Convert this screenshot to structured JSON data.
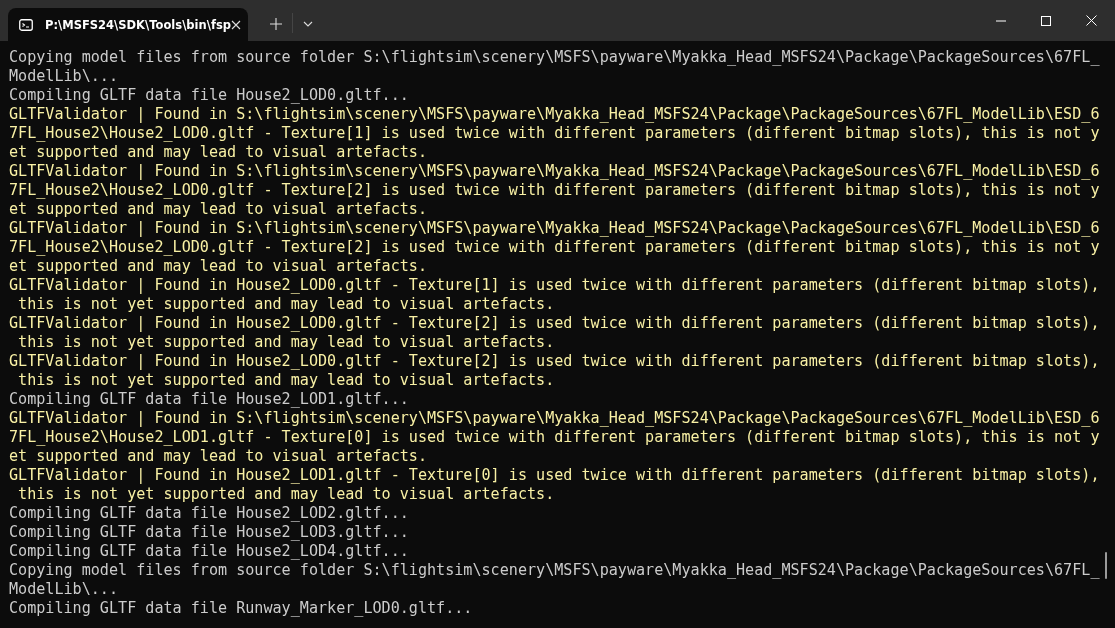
{
  "window": {
    "tab": {
      "title": "P:\\MSFS24\\SDK\\Tools\\bin\\fsp",
      "selected": true
    }
  },
  "lines": [
    {
      "text": "Copying model files from source folder S:\\flightsim\\scenery\\MSFS\\payware\\Myakka_Head_MSFS24\\Package\\PackageSources\\67FL_",
      "kind": "info"
    },
    {
      "text": "ModelLib\\...",
      "kind": "info"
    },
    {
      "text": "Compiling GLTF data file House2_LOD0.gltf...",
      "kind": "info"
    },
    {
      "text": "GLTFValidator | Found in S:\\flightsim\\scenery\\MSFS\\payware\\Myakka_Head_MSFS24\\Package\\PackageSources\\67FL_ModelLib\\ESD_6",
      "kind": "warning"
    },
    {
      "text": "7FL_House2\\House2_LOD0.gltf - Texture[1] is used twice with different parameters (different bitmap slots), this is not y",
      "kind": "warning"
    },
    {
      "text": "et supported and may lead to visual artefacts.",
      "kind": "warning"
    },
    {
      "text": "GLTFValidator | Found in S:\\flightsim\\scenery\\MSFS\\payware\\Myakka_Head_MSFS24\\Package\\PackageSources\\67FL_ModelLib\\ESD_6",
      "kind": "warning"
    },
    {
      "text": "7FL_House2\\House2_LOD0.gltf - Texture[2] is used twice with different parameters (different bitmap slots), this is not y",
      "kind": "warning"
    },
    {
      "text": "et supported and may lead to visual artefacts.",
      "kind": "warning"
    },
    {
      "text": "GLTFValidator | Found in S:\\flightsim\\scenery\\MSFS\\payware\\Myakka_Head_MSFS24\\Package\\PackageSources\\67FL_ModelLib\\ESD_6",
      "kind": "warning"
    },
    {
      "text": "7FL_House2\\House2_LOD0.gltf - Texture[2] is used twice with different parameters (different bitmap slots), this is not y",
      "kind": "warning"
    },
    {
      "text": "et supported and may lead to visual artefacts.",
      "kind": "warning"
    },
    {
      "text": "GLTFValidator | Found in House2_LOD0.gltf - Texture[1] is used twice with different parameters (different bitmap slots),",
      "kind": "warning"
    },
    {
      "text": " this is not yet supported and may lead to visual artefacts.",
      "kind": "warning"
    },
    {
      "text": "GLTFValidator | Found in House2_LOD0.gltf - Texture[2] is used twice with different parameters (different bitmap slots),",
      "kind": "warning"
    },
    {
      "text": " this is not yet supported and may lead to visual artefacts.",
      "kind": "warning"
    },
    {
      "text": "GLTFValidator | Found in House2_LOD0.gltf - Texture[2] is used twice with different parameters (different bitmap slots),",
      "kind": "warning"
    },
    {
      "text": " this is not yet supported and may lead to visual artefacts.",
      "kind": "warning"
    },
    {
      "text": "Compiling GLTF data file House2_LOD1.gltf...",
      "kind": "info"
    },
    {
      "text": "GLTFValidator | Found in S:\\flightsim\\scenery\\MSFS\\payware\\Myakka_Head_MSFS24\\Package\\PackageSources\\67FL_ModelLib\\ESD_6",
      "kind": "warning"
    },
    {
      "text": "7FL_House2\\House2_LOD1.gltf - Texture[0] is used twice with different parameters (different bitmap slots), this is not y",
      "kind": "warning"
    },
    {
      "text": "et supported and may lead to visual artefacts.",
      "kind": "warning"
    },
    {
      "text": "GLTFValidator | Found in House2_LOD1.gltf - Texture[0] is used twice with different parameters (different bitmap slots),",
      "kind": "warning"
    },
    {
      "text": " this is not yet supported and may lead to visual artefacts.",
      "kind": "warning"
    },
    {
      "text": "Compiling GLTF data file House2_LOD2.gltf...",
      "kind": "info"
    },
    {
      "text": "Compiling GLTF data file House2_LOD3.gltf...",
      "kind": "info"
    },
    {
      "text": "Compiling GLTF data file House2_LOD4.gltf...",
      "kind": "info"
    },
    {
      "text": "Copying model files from source folder S:\\flightsim\\scenery\\MSFS\\payware\\Myakka_Head_MSFS24\\Package\\PackageSources\\67FL_",
      "kind": "info"
    },
    {
      "text": "ModelLib\\...",
      "kind": "info"
    },
    {
      "text": "Compiling GLTF data file Runway_Marker_LOD0.gltf...",
      "kind": "info"
    }
  ]
}
